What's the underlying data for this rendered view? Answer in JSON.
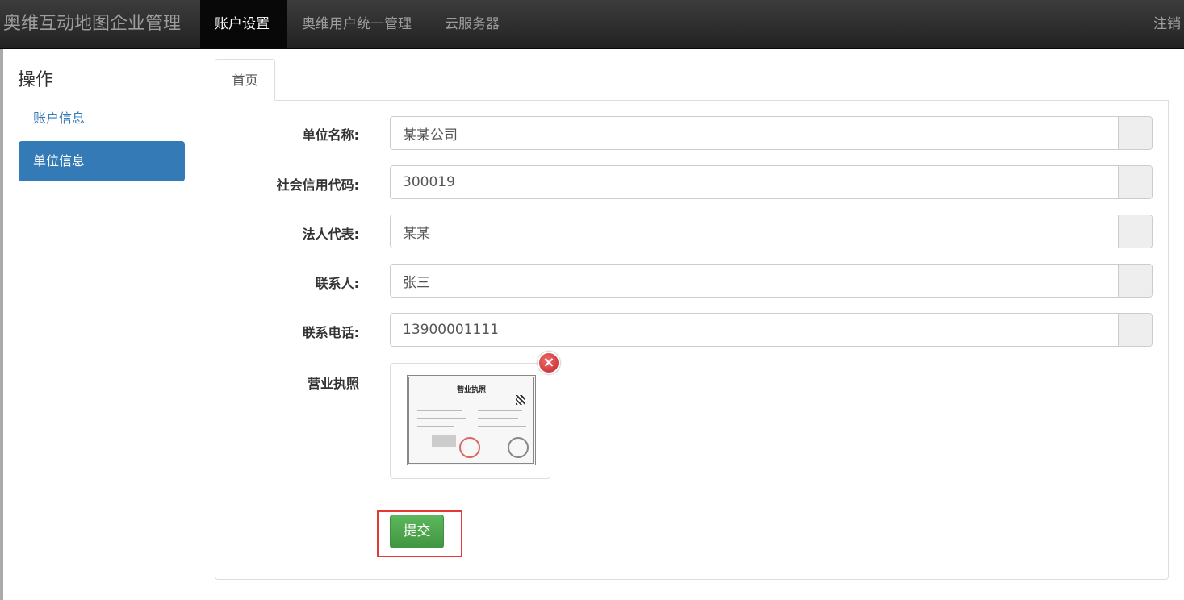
{
  "navbar": {
    "brand": "奥维互动地图企业管理",
    "items": [
      "账户设置",
      "奥维用户统一管理",
      "云服务器"
    ],
    "logout": "注销"
  },
  "sidebar": {
    "title": "操作",
    "items": [
      "账户信息",
      "单位信息"
    ]
  },
  "tab": "首页",
  "form": {
    "company_name_label": "单位名称:",
    "company_name_value": "某某公司",
    "credit_code_label": "社会信用代码:",
    "credit_code_value": "300019",
    "legal_rep_label": "法人代表:",
    "legal_rep_value": "某某",
    "contact_label": "联系人:",
    "contact_value": "张三",
    "phone_label": "联系电话:",
    "phone_value": "13900001111",
    "license_label": "营业执照",
    "license_title": "营业执照",
    "submit_label": "提交"
  },
  "colors": {
    "navbar": "#222222",
    "active_nav": "#080808",
    "primary": "#337ab7",
    "success": "#5cb85c",
    "highlight_border": "#e53935"
  }
}
